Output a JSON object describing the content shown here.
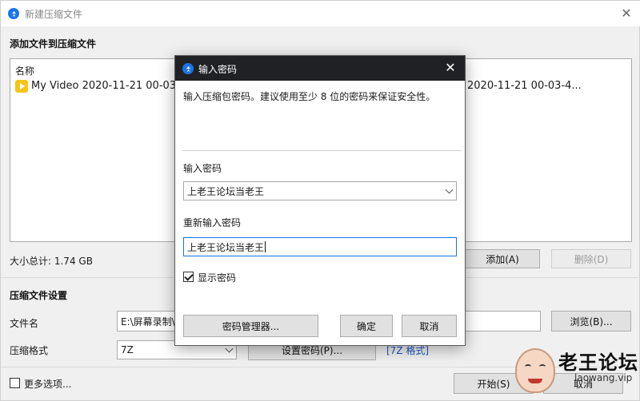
{
  "bg_window": {
    "title": "新建压缩文件",
    "add_section_title": "添加文件到压缩文件",
    "list_column_name": "名称",
    "file_name_left": "My Video 2020-11-21 00-03-48",
    "file_name_right": "2020-11-21 00-03-4...",
    "total_size": "大小总计: 1.74 GB",
    "add_button": "添加(A)",
    "remove_button": "删除(D)",
    "settings_title": "压缩文件设置",
    "filename_label": "文件名",
    "filename_value": "E:\\屏幕录制\\",
    "browse_button": "浏览(B)...",
    "format_label": "压缩格式",
    "format_value": "7Z",
    "set_password_button": "设置密码(P)...",
    "format_link": "[7Z 格式]",
    "more_options": "更多选项...",
    "start_button": "开始(S)",
    "cancel_button": "取消"
  },
  "dialog": {
    "title": "输入密码",
    "instruction": "输入压缩包密码。建议使用至少 8 位的密码来保证安全性。",
    "password_label": "输入密码",
    "password_value": "上老王论坛当老王",
    "confirm_label": "重新输入密码",
    "confirm_value": "上老王论坛当老王",
    "show_password_label": "显示密码",
    "show_password_checked": true,
    "password_manager_button": "密码管理器...",
    "ok_button": "确定",
    "cancel_button": "取消"
  },
  "watermark": {
    "brand": "老王论坛",
    "domain": "laowang.vip"
  },
  "colors": {
    "accent": "#1a73e8",
    "dialog_titlebar": "#202124",
    "link": "#1a56c4",
    "video_icon": "#f5c518"
  }
}
